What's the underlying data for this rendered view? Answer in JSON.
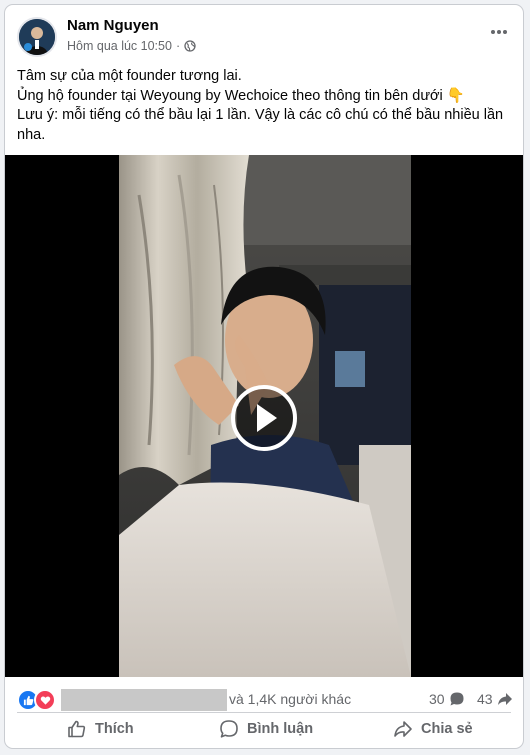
{
  "post": {
    "author": "Nam Nguyen",
    "timestamp": "Hôm qua lúc 10:50",
    "privacy_icon": "globe-icon",
    "text_lines": [
      "Tâm sự của một founder tương lai.",
      "Ủng hộ founder tại Weyoung by Wechoice theo thông tin bên dưới 👇",
      "Lưu ý: mỗi tiếng có thể bầu lại 1 lần. Vậy là các cô chú có thể bầu nhiều lần",
      "nha."
    ]
  },
  "video": {
    "play_icon": "play-icon"
  },
  "reactions": {
    "types": [
      "like",
      "love"
    ],
    "others_text": "và 1,4K người khác",
    "comment_count": "30",
    "share_count": "43"
  },
  "actions": {
    "like_label": "Thích",
    "comment_label": "Bình luận",
    "share_label": "Chia sẻ"
  },
  "colors": {
    "like_blue": "#1877f2",
    "love_red": "#f33e58",
    "secondary_text": "#65676b"
  }
}
